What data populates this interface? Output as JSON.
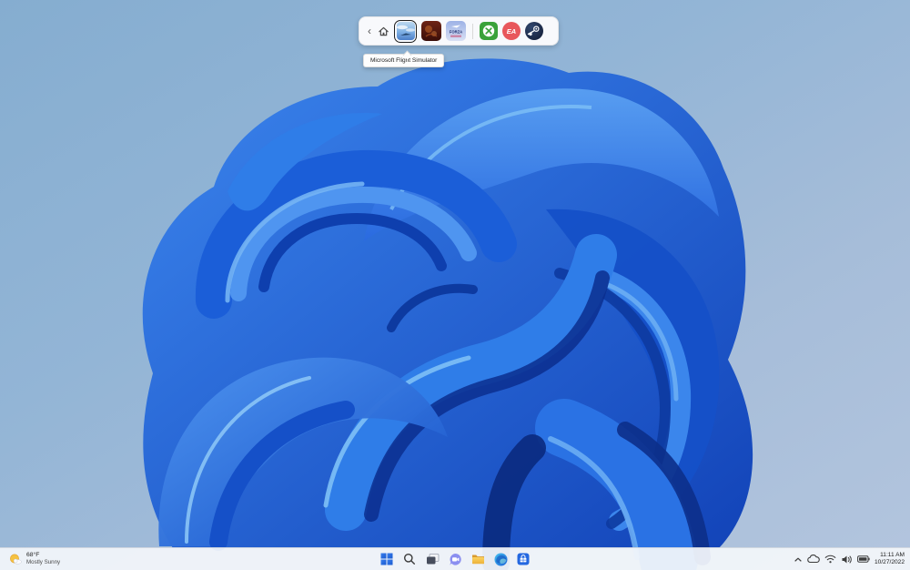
{
  "wallpaper": {
    "name": "Windows 11 Bloom light",
    "colors": {
      "desktop_top": "#85add0",
      "desktop_bottom": "#b3c5de",
      "bloom_primary": "#2f7de8",
      "bloom_dark": "#0d3aa0",
      "bloom_light": "#6fb0f4"
    }
  },
  "game_bar": {
    "back_icon": "‹",
    "tooltip": "Microsoft Flight Simulator",
    "games": [
      {
        "label": "Microsoft Flight Simulator",
        "selected": true,
        "icon": "flight-simulator-cover"
      },
      {
        "label": "game-cover-dark-red",
        "selected": false,
        "icon": "game-cover-dark-red"
      },
      {
        "label": "Forza game",
        "selected": false,
        "icon": "forza-cover",
        "logo_text": "FORZA"
      }
    ],
    "launchers": [
      {
        "label": "Xbox",
        "icon": "xbox-sphere",
        "color": "#3aa23a"
      },
      {
        "label": "EA",
        "icon": "ea-logo",
        "logo_text": "EA",
        "color": "#e8575c"
      },
      {
        "label": "Steam",
        "icon": "steam-logo",
        "color": "#1e2a44"
      }
    ]
  },
  "taskbar": {
    "weather": {
      "temperature": "68°F",
      "condition": "Mostly Sunny",
      "icon": "partly-sunny"
    },
    "buttons": [
      {
        "label": "Start",
        "icon": "windows-logo"
      },
      {
        "label": "Search",
        "icon": "magnifier"
      },
      {
        "label": "Task View",
        "icon": "stacked-windows"
      },
      {
        "label": "Chat",
        "icon": "video-chat-bubble"
      },
      {
        "label": "File Explorer",
        "icon": "folder"
      },
      {
        "label": "Microsoft Edge",
        "icon": "edge-swirl"
      },
      {
        "label": "Microsoft Store",
        "icon": "store-bag"
      }
    ],
    "tray": {
      "chevron_label": "Show hidden icons",
      "icons": [
        "onedrive-cloud",
        "wifi",
        "volume",
        "battery"
      ],
      "time": "11:11 AM",
      "date": "10/27/2022"
    }
  }
}
